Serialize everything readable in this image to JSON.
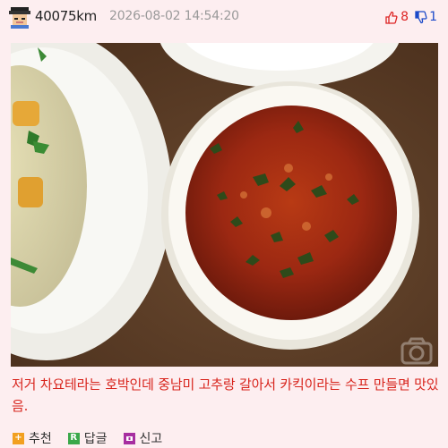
{
  "post": {
    "username": "40075km",
    "timestamp": "2026-08-02 14:54:20",
    "upvotes": "8",
    "downvotes": "1",
    "caption": "저거 차요테라는 호박인데 중남미 고추랑 갈아서 카킥이라는 수프 만들면 맛있음."
  },
  "actions": {
    "recommend_label": "추천",
    "reply_label": "답글",
    "report_label": "신고"
  },
  "icons": {
    "avatar": "pixel-avatar-icon",
    "upvote": "thumbs-up-icon",
    "downvote": "thumbs-down-icon",
    "recommend": "plus-icon",
    "reply": "reply-icon",
    "report": "report-icon",
    "watermark": "camera-icon"
  },
  "colors": {
    "background": "#fdeef0",
    "caption": "#d8241c",
    "upvote": "#dd2222",
    "downvote": "#1a49c9"
  }
}
